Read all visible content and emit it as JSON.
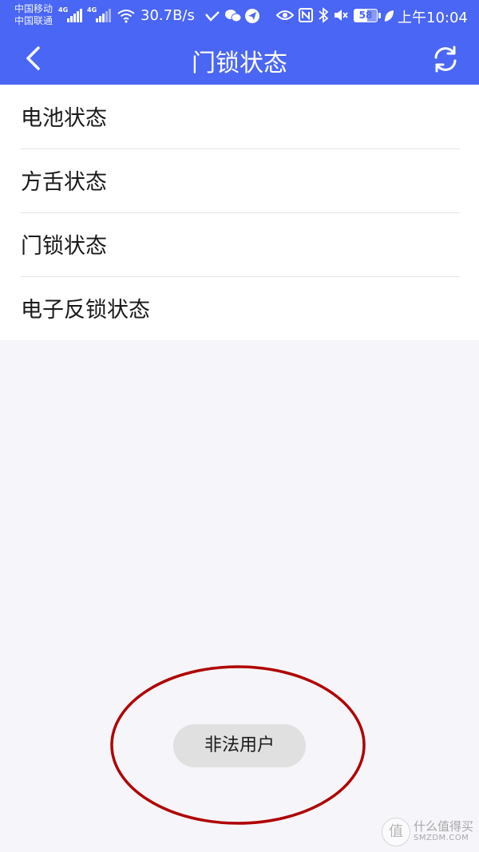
{
  "status_bar": {
    "carrier_1": "中国移动",
    "carrier_2": "中国联通",
    "network_1": "4G",
    "network_2": "4G",
    "speed": "30.7B/s",
    "battery_level": "58",
    "time": "上午10:04"
  },
  "nav": {
    "title": "门锁状态",
    "back_icon": "chevron-left-icon",
    "refresh_icon": "refresh-icon"
  },
  "status_list": {
    "items": [
      {
        "label": "电池状态"
      },
      {
        "label": "方舌状态"
      },
      {
        "label": "门锁状态"
      },
      {
        "label": "电子反锁状态"
      }
    ]
  },
  "toast": {
    "message": "非法用户"
  },
  "annotation": {
    "color": "#b00000"
  },
  "watermark": {
    "glyph": "值",
    "brand": "什么值得买",
    "site": "SMZDM.COM"
  },
  "colors": {
    "header": "#4a66f5",
    "background": "#f5f5fa",
    "list_background": "#ffffff",
    "toast_background": "#e0e0e0"
  }
}
